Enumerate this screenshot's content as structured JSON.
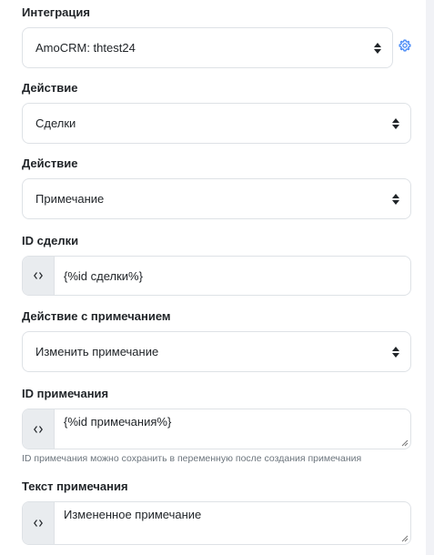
{
  "fields": {
    "integration": {
      "label": "Интеграция",
      "value": "AmoCRM: thtest24"
    },
    "action1": {
      "label": "Действие",
      "value": "Сделки"
    },
    "action2": {
      "label": "Действие",
      "value": "Примечание"
    },
    "deal_id": {
      "label": "ID сделки",
      "value": "{%id сделки%}",
      "addon": "<>"
    },
    "note_action": {
      "label": "Действие с примечанием",
      "value": "Изменить примечание"
    },
    "note_id": {
      "label": "ID примечания",
      "value": "{%id примечания%}",
      "addon": "<>",
      "hint": "ID примечания можно сохранить в переменную после создания примечания"
    },
    "note_text": {
      "label": "Текст примечания",
      "value": "Измененное примечание",
      "addon": "<>"
    }
  },
  "colors": {
    "accent": "#3b82f6",
    "addon_bg": "#e9ecef",
    "border": "#dee2e6",
    "hint": "#6c757d"
  },
  "icons": {
    "settings": "gear-icon",
    "select_arrows": "sort-arrows-icon",
    "code": "code-brackets-icon",
    "resize": "resize-handle-icon"
  }
}
